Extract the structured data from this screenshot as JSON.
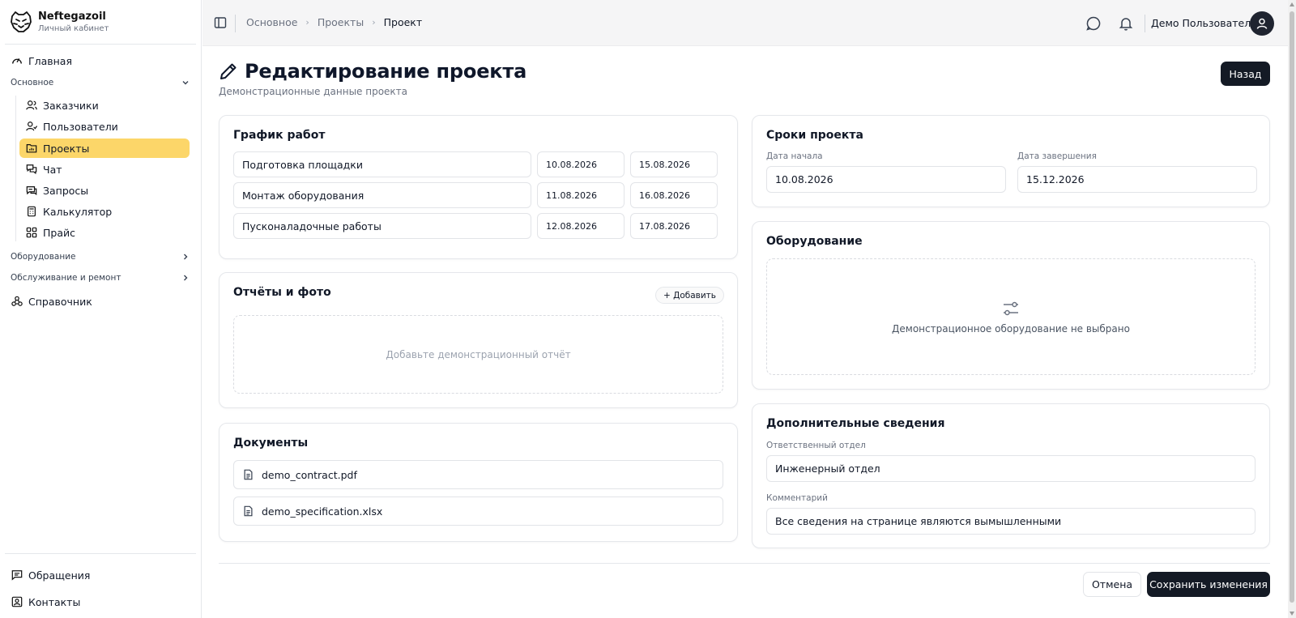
{
  "brand": {
    "name": "Neftegazoil",
    "subtitle": "Личный кабинет"
  },
  "sidebar": {
    "home": "Главная",
    "group_main": "Основное",
    "sub_items": [
      {
        "label": "Заказчики",
        "icon": "users-icon"
      },
      {
        "label": "Пользователи",
        "icon": "user-check-icon"
      },
      {
        "label": "Проекты",
        "icon": "folder-chart-icon",
        "active": true
      },
      {
        "label": "Чат",
        "icon": "chat-icon"
      },
      {
        "label": "Запросы",
        "icon": "inbox-icon"
      },
      {
        "label": "Калькулятор",
        "icon": "calculator-icon"
      },
      {
        "label": "Прайс",
        "icon": "grid-icon"
      }
    ],
    "group_equipment": "Оборудование",
    "group_service": "Обслуживание и ремонт",
    "reference": "Справочник",
    "appeals": "Обращения",
    "contacts": "Контакты"
  },
  "header": {
    "breadcrumbs": [
      "Основное",
      "Проекты",
      "Проект"
    ],
    "user_name": "Демо Пользователь"
  },
  "page": {
    "title": "Редактирование проекта",
    "subtitle": "Демонстрационные данные проекта",
    "back_label": "Назад"
  },
  "schedule": {
    "title": "График работ",
    "rows": [
      {
        "name": "Подготовка площадки",
        "start": "10.08.2026",
        "end": "15.08.2026"
      },
      {
        "name": "Монтаж оборудования",
        "start": "11.08.2026",
        "end": "16.08.2026"
      },
      {
        "name": "Пусконаладочные работы",
        "start": "12.08.2026",
        "end": "17.08.2026"
      }
    ]
  },
  "reports": {
    "title": "Отчёты и фото",
    "add_label": "+ Добавить",
    "empty_text": "Добавьте демонстрационный отчёт"
  },
  "documents": {
    "title": "Документы",
    "files": [
      "demo_contract.pdf",
      "demo_specification.xlsx"
    ]
  },
  "terms": {
    "title": "Сроки проекта",
    "start_label": "Дата начала",
    "start_value": "10.08.2026",
    "end_label": "Дата завершения",
    "end_value": "15.12.2026"
  },
  "equipment": {
    "title": "Оборудование",
    "empty_text": "Демонстрационное оборудование не выбрано"
  },
  "extra": {
    "title": "Дополнительные сведения",
    "dept_label": "Ответственный отдел",
    "dept_value": "Инженерный отдел",
    "comment_label": "Комментарий",
    "comment_value": "Все сведения на странице являются вымышленными"
  },
  "actions": {
    "cancel": "Отмена",
    "save": "Сохранить изменения"
  },
  "colors": {
    "active_nav": "#fcd669",
    "dark_button": "#141a25"
  }
}
